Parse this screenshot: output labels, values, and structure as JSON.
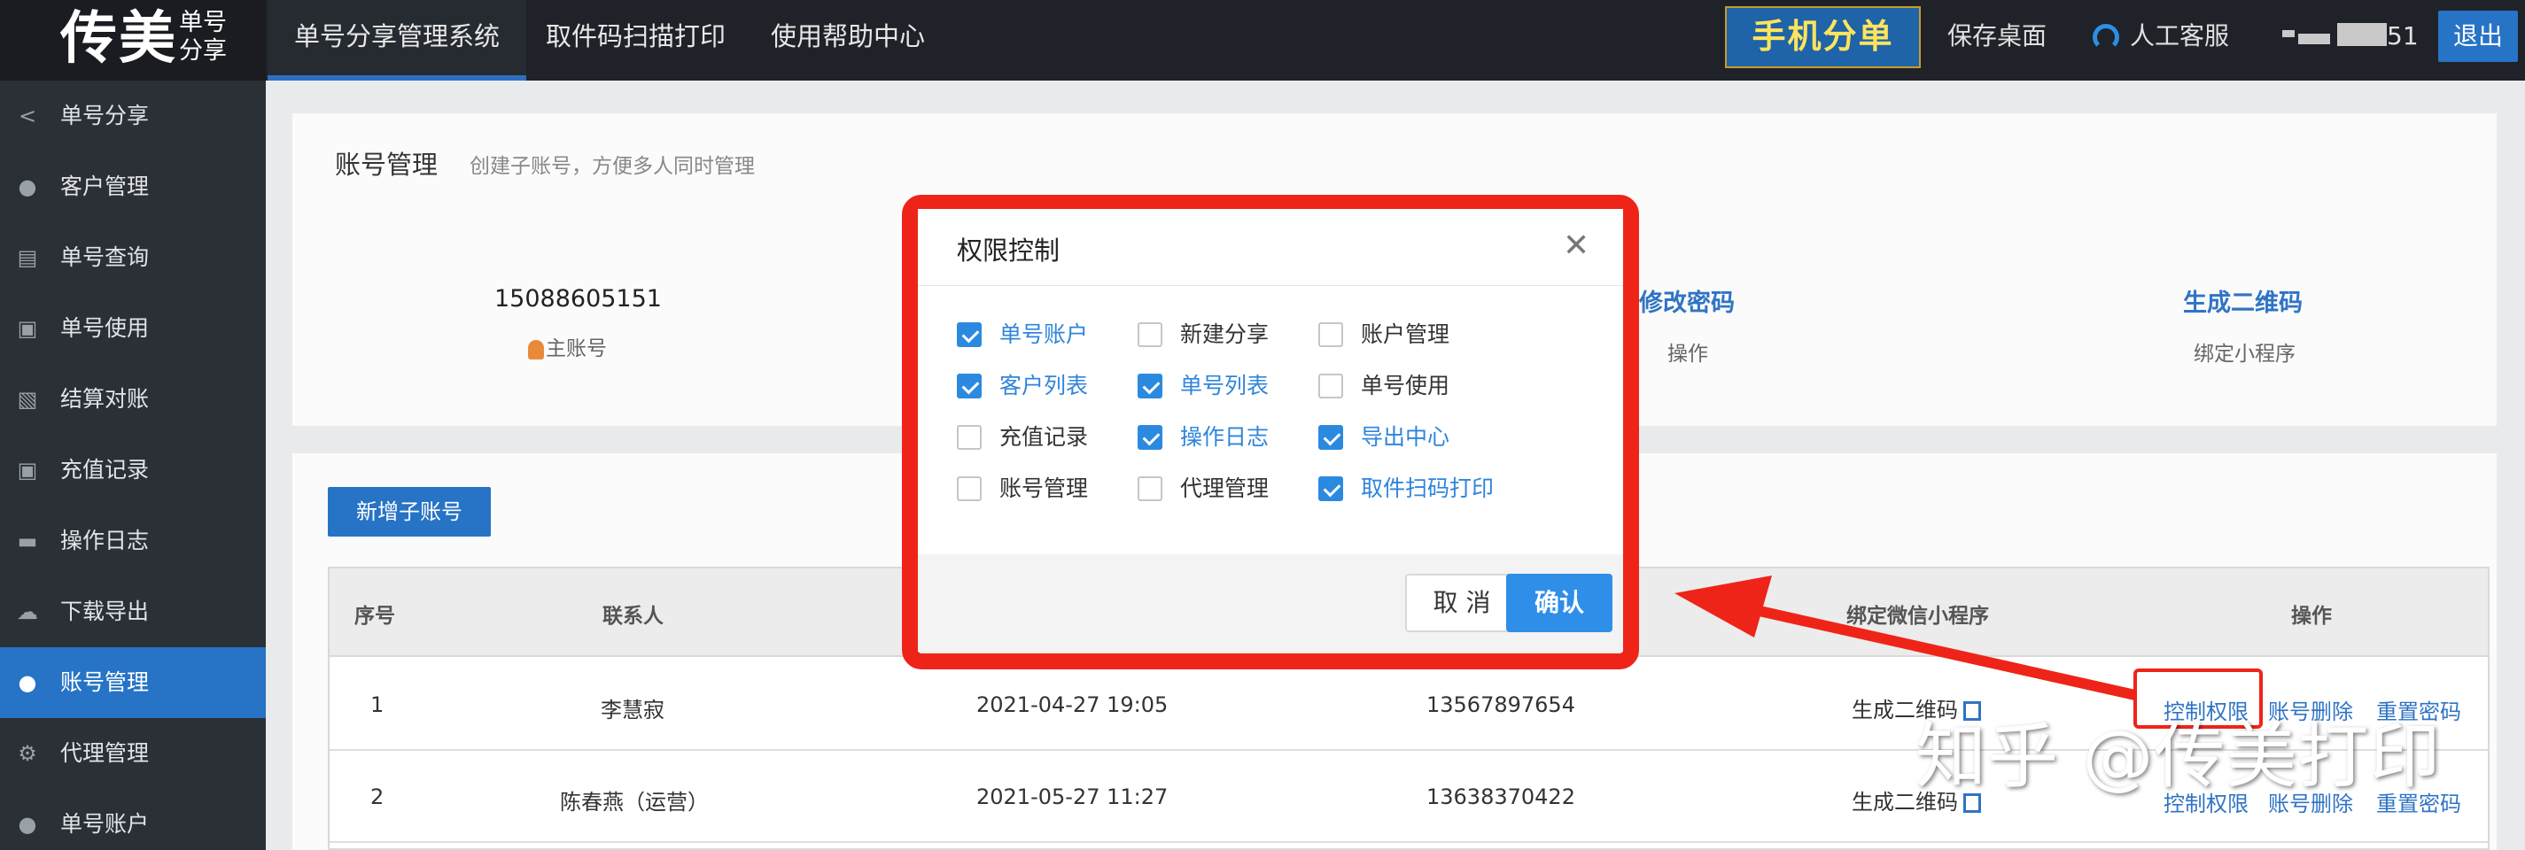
{
  "brand": {
    "big": "传美",
    "small_top": "单号",
    "small_bottom": "分享"
  },
  "top_nav": [
    {
      "label": "单号分享管理系统"
    },
    {
      "label": "取件码扫描打印"
    },
    {
      "label": "使用帮助中心"
    }
  ],
  "top_right": {
    "promo": "手机分单",
    "save_desktop": "保存桌面",
    "support": "人工客服",
    "account_suffix": "51",
    "logout": "退出"
  },
  "sidebar": [
    {
      "label": "单号分享",
      "icon": "share-icon"
    },
    {
      "label": "客户管理",
      "icon": "user-icon"
    },
    {
      "label": "单号查询",
      "icon": "clipboard-icon"
    },
    {
      "label": "单号使用",
      "icon": "clipboard-check-icon"
    },
    {
      "label": "结算对账",
      "icon": "clipboard-x-icon"
    },
    {
      "label": "充值记录",
      "icon": "clipboard-check-icon"
    },
    {
      "label": "操作日志",
      "icon": "briefcase-icon"
    },
    {
      "label": "下载导出",
      "icon": "cloud-icon"
    },
    {
      "label": "账号管理",
      "icon": "user-icon",
      "active": true
    },
    {
      "label": "代理管理",
      "icon": "gear-icon"
    },
    {
      "label": "单号账户",
      "icon": "user-icon"
    }
  ],
  "page": {
    "title": "账号管理",
    "subtitle": "创建子账号，方便多人同时管理"
  },
  "summary": {
    "main_account_phone": "15088605151",
    "main_account_label": "主账号",
    "change_password": "修改密码",
    "change_password_sub": "操作",
    "gen_qr": "生成二维码",
    "gen_qr_sub": "绑定小程序"
  },
  "add_button": "新增子账号",
  "table": {
    "headers": {
      "index": "序号",
      "contact": "联系人",
      "wechat": "绑定微信小程序",
      "ops": "操作"
    },
    "rows": [
      {
        "index": "1",
        "contact": "李慧寂",
        "time": "2021-04-27 19:05",
        "phone": "13567897654",
        "qr": "生成二维码",
        "op1": "控制权限",
        "op2": "账号删除",
        "op3": "重置密码"
      },
      {
        "index": "2",
        "contact": "陈春燕（运营）",
        "time": "2021-05-27 11:27",
        "phone": "13638370422",
        "qr": "生成二维码",
        "op1": "控制权限",
        "op2": "账号删除",
        "op3": "重置密码"
      }
    ]
  },
  "modal": {
    "title": "权限控制",
    "permissions": [
      {
        "label": "单号账户",
        "checked": true
      },
      {
        "label": "新建分享",
        "checked": false
      },
      {
        "label": "账户管理",
        "checked": false
      },
      {
        "label": "客户列表",
        "checked": true
      },
      {
        "label": "单号列表",
        "checked": true
      },
      {
        "label": "单号使用",
        "checked": false
      },
      {
        "label": "充值记录",
        "checked": false
      },
      {
        "label": "操作日志",
        "checked": true
      },
      {
        "label": "导出中心",
        "checked": true
      },
      {
        "label": "账号管理",
        "checked": false
      },
      {
        "label": "代理管理",
        "checked": false
      },
      {
        "label": "取件扫码打印",
        "checked": true
      }
    ],
    "cancel": "取 消",
    "confirm": "确认"
  },
  "watermark": "知乎 @传美打印",
  "colors": {
    "primary": "#2773c5",
    "highlight": "#ef2418",
    "link": "#2f74c4"
  }
}
